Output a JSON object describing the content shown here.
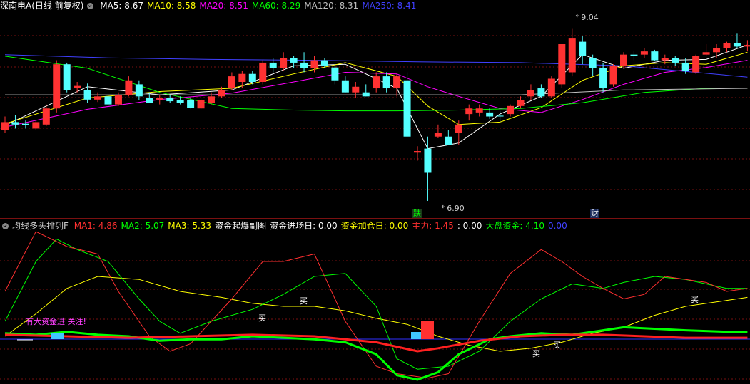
{
  "header1": {
    "title": "深南电A(日线 前复权)",
    "ma": [
      {
        "label": "MA5: 8.67",
        "color": "#ffffff"
      },
      {
        "label": "MA10: 8.58",
        "color": "#ffff00"
      },
      {
        "label": "MA20: 8.51",
        "color": "#ff00ff"
      },
      {
        "label": "MA60: 8.29",
        "color": "#00ff00"
      },
      {
        "label": "MA120: 8.31",
        "color": "#c0c0c0"
      },
      {
        "label": "MA250: 8.41",
        "color": "#4040ff"
      }
    ]
  },
  "header2": {
    "title": "均线多头排列F",
    "items": [
      {
        "label": "MA1: 4.86",
        "color": "#ff3030"
      },
      {
        "label": "MA2: 5.07",
        "color": "#00ff00"
      },
      {
        "label": "MA3: 5.33",
        "color": "#ffff00"
      },
      {
        "label": "资金起爆副图",
        "color": "#ffffff"
      },
      {
        "label": "资金进场日: 0.00",
        "color": "#ffffff"
      },
      {
        "label": "资金加仓日: 0.00",
        "color": "#ffff00"
      },
      {
        "label": "主力: 1.45",
        "color": "#ff3030"
      },
      {
        "label": ": 0.00",
        "color": "#ffffff"
      },
      {
        "label": "大盘资金: 4.10",
        "color": "#00ff00"
      },
      {
        "label": "0.00",
        "color": "#4040ff"
      }
    ]
  },
  "annotations": {
    "high": "9.04",
    "low": "6.90",
    "tag_die": "跌",
    "tag_cai": "财",
    "capital_note": "有大资金进 关注!",
    "buy": "买"
  },
  "colors": {
    "up": "#ff3232",
    "down": "#54ffff",
    "grid": "#7a1010"
  },
  "chart_data": {
    "type": "candlestick",
    "title": "深南电A(日线 前复权)",
    "high_label": 9.04,
    "low_label": 6.9,
    "ohlc": [
      [
        7.78,
        7.95,
        7.75,
        7.88
      ],
      [
        7.88,
        7.97,
        7.8,
        7.85
      ],
      [
        7.86,
        7.9,
        7.8,
        7.84
      ],
      [
        7.8,
        7.9,
        7.78,
        7.88
      ],
      [
        7.85,
        8.1,
        7.83,
        8.05
      ],
      [
        8.05,
        8.65,
        8.0,
        8.6
      ],
      [
        8.6,
        8.62,
        8.25,
        8.28
      ],
      [
        8.3,
        8.38,
        8.25,
        8.33
      ],
      [
        8.28,
        8.36,
        8.12,
        8.16
      ],
      [
        8.16,
        8.25,
        8.13,
        8.2
      ],
      [
        8.2,
        8.28,
        8.15,
        8.1
      ],
      [
        8.1,
        8.25,
        8.08,
        8.22
      ],
      [
        8.22,
        8.45,
        8.2,
        8.4
      ],
      [
        8.35,
        8.4,
        8.15,
        8.2
      ],
      [
        8.18,
        8.25,
        8.12,
        8.12
      ],
      [
        8.16,
        8.22,
        8.1,
        8.18
      ],
      [
        8.18,
        8.22,
        8.12,
        8.14
      ],
      [
        8.15,
        8.2,
        8.1,
        8.12
      ],
      [
        8.15,
        8.18,
        8.05,
        8.06
      ],
      [
        8.05,
        8.18,
        8.04,
        8.15
      ],
      [
        8.12,
        8.25,
        8.1,
        8.2
      ],
      [
        8.2,
        8.32,
        8.18,
        8.28
      ],
      [
        8.3,
        8.5,
        8.28,
        8.45
      ],
      [
        8.38,
        8.52,
        8.3,
        8.48
      ],
      [
        8.48,
        8.52,
        8.35,
        8.38
      ],
      [
        8.38,
        8.65,
        8.35,
        8.62
      ],
      [
        8.62,
        8.68,
        8.5,
        8.55
      ],
      [
        8.55,
        8.75,
        8.52,
        8.68
      ],
      [
        8.68,
        8.7,
        8.55,
        8.62
      ],
      [
        8.62,
        8.75,
        8.5,
        8.55
      ],
      [
        8.55,
        8.7,
        8.5,
        8.65
      ],
      [
        8.65,
        8.68,
        8.55,
        8.58
      ],
      [
        8.56,
        8.6,
        8.35,
        8.4
      ],
      [
        8.4,
        8.45,
        8.25,
        8.25
      ],
      [
        8.25,
        8.38,
        8.18,
        8.32
      ],
      [
        8.25,
        8.35,
        8.2,
        8.2
      ],
      [
        8.3,
        8.5,
        8.25,
        8.45
      ],
      [
        8.45,
        8.5,
        8.25,
        8.3
      ],
      [
        8.3,
        8.48,
        8.2,
        8.45
      ],
      [
        8.4,
        8.5,
        7.7,
        7.7
      ],
      [
        7.5,
        7.58,
        7.4,
        7.52
      ],
      [
        7.55,
        7.7,
        6.9,
        7.25
      ],
      [
        7.7,
        7.85,
        7.68,
        7.75
      ],
      [
        7.7,
        7.78,
        7.6,
        7.6
      ],
      [
        7.75,
        7.9,
        7.6,
        7.85
      ],
      [
        7.98,
        8.1,
        7.9,
        8.05
      ],
      [
        8.0,
        8.1,
        7.95,
        8.05
      ],
      [
        8.0,
        8.06,
        7.92,
        7.95
      ],
      [
        7.96,
        8.02,
        7.88,
        7.95
      ],
      [
        7.98,
        8.1,
        7.95,
        8.08
      ],
      [
        8.08,
        8.2,
        8.05,
        8.15
      ],
      [
        8.2,
        8.35,
        8.15,
        8.28
      ],
      [
        8.3,
        8.35,
        8.18,
        8.2
      ],
      [
        8.2,
        8.45,
        8.18,
        8.42
      ],
      [
        8.35,
        8.8,
        8.3,
        8.85
      ],
      [
        8.5,
        9.04,
        8.45,
        8.92
      ],
      [
        8.88,
        8.95,
        8.6,
        8.7
      ],
      [
        8.68,
        8.72,
        8.45,
        8.55
      ],
      [
        8.55,
        8.62,
        8.25,
        8.3
      ],
      [
        8.35,
        8.6,
        8.32,
        8.58
      ],
      [
        8.58,
        8.75,
        8.55,
        8.72
      ],
      [
        8.72,
        8.76,
        8.65,
        8.7
      ],
      [
        8.72,
        8.8,
        8.68,
        8.76
      ],
      [
        8.76,
        8.78,
        8.64,
        8.65
      ],
      [
        8.65,
        8.72,
        8.6,
        8.68
      ],
      [
        8.68,
        8.7,
        8.58,
        8.62
      ],
      [
        8.62,
        8.68,
        8.48,
        8.52
      ],
      [
        8.5,
        8.72,
        8.48,
        8.7
      ],
      [
        8.72,
        8.85,
        8.7,
        8.75
      ],
      [
        8.75,
        8.85,
        8.68,
        8.8
      ],
      [
        8.8,
        8.88,
        8.75,
        8.86
      ],
      [
        8.86,
        8.98,
        8.8,
        8.82
      ],
      [
        8.82,
        8.9,
        8.76,
        8.84
      ]
    ],
    "series": [
      {
        "name": "MA5",
        "color": "#ffffff",
        "values": [
          [
            0,
            7.84
          ],
          [
            8,
            8.32
          ],
          [
            15,
            8.22
          ],
          [
            22,
            8.28
          ],
          [
            28,
            8.58
          ],
          [
            33,
            8.6
          ],
          [
            38,
            8.3
          ],
          [
            41,
            7.55
          ],
          [
            44,
            7.62
          ],
          [
            48,
            7.98
          ],
          [
            52,
            8.2
          ],
          [
            56,
            8.72
          ],
          [
            60,
            8.55
          ],
          [
            64,
            8.65
          ],
          [
            68,
            8.66
          ],
          [
            72,
            8.84
          ]
        ]
      },
      {
        "name": "MA10",
        "color": "#ffff00",
        "values": [
          [
            0,
            7.86
          ],
          [
            8,
            8.18
          ],
          [
            15,
            8.26
          ],
          [
            22,
            8.3
          ],
          [
            28,
            8.48
          ],
          [
            33,
            8.62
          ],
          [
            38,
            8.45
          ],
          [
            41,
            8.08
          ],
          [
            44,
            7.85
          ],
          [
            48,
            7.88
          ],
          [
            52,
            8.06
          ],
          [
            56,
            8.4
          ],
          [
            60,
            8.58
          ],
          [
            64,
            8.62
          ],
          [
            68,
            8.6
          ],
          [
            72,
            8.75
          ]
        ]
      },
      {
        "name": "MA20",
        "color": "#ff00ff",
        "values": [
          [
            0,
            7.82
          ],
          [
            8,
            8.04
          ],
          [
            15,
            8.16
          ],
          [
            22,
            8.24
          ],
          [
            28,
            8.38
          ],
          [
            33,
            8.5
          ],
          [
            38,
            8.48
          ],
          [
            41,
            8.32
          ],
          [
            44,
            8.2
          ],
          [
            48,
            8.05
          ],
          [
            52,
            8.0
          ],
          [
            56,
            8.16
          ],
          [
            60,
            8.35
          ],
          [
            64,
            8.5
          ],
          [
            68,
            8.56
          ],
          [
            72,
            8.65
          ]
        ]
      },
      {
        "name": "MA60",
        "color": "#00ff00",
        "values": [
          [
            0,
            8.7
          ],
          [
            8,
            8.55
          ],
          [
            15,
            8.25
          ],
          [
            22,
            8.05
          ],
          [
            28,
            8.03
          ],
          [
            33,
            8.02
          ],
          [
            38,
            8.02
          ],
          [
            44,
            8.03
          ],
          [
            50,
            8.05
          ],
          [
            56,
            8.12
          ],
          [
            62,
            8.25
          ],
          [
            68,
            8.3
          ],
          [
            72,
            8.3
          ]
        ]
      },
      {
        "name": "MA120",
        "color": "#c0c0c0",
        "values": [
          [
            0,
            8.22
          ],
          [
            10,
            8.22
          ],
          [
            20,
            8.22
          ],
          [
            30,
            8.22
          ],
          [
            40,
            8.22
          ],
          [
            50,
            8.22
          ],
          [
            60,
            8.28
          ],
          [
            72,
            8.3
          ]
        ]
      },
      {
        "name": "MA250",
        "color": "#4040ff",
        "values": [
          [
            0,
            8.72
          ],
          [
            10,
            8.68
          ],
          [
            20,
            8.66
          ],
          [
            30,
            8.65
          ],
          [
            40,
            8.63
          ],
          [
            50,
            8.62
          ],
          [
            60,
            8.58
          ],
          [
            72,
            8.44
          ]
        ]
      }
    ],
    "subchart": {
      "MA1": [
        [
          0,
          60
        ],
        [
          3,
          100
        ],
        [
          6,
          90
        ],
        [
          9,
          85
        ],
        [
          11,
          60
        ],
        [
          14,
          30
        ],
        [
          16,
          20
        ],
        [
          18,
          25
        ],
        [
          22,
          55
        ],
        [
          25,
          80
        ],
        [
          27,
          80
        ],
        [
          30,
          85
        ],
        [
          33,
          40
        ],
        [
          36,
          10
        ],
        [
          38,
          5
        ],
        [
          41,
          2
        ],
        [
          43,
          5
        ],
        [
          46,
          40
        ],
        [
          49,
          72
        ],
        [
          52,
          88
        ],
        [
          54,
          80
        ],
        [
          56,
          70
        ],
        [
          58,
          62
        ],
        [
          60,
          55
        ],
        [
          62,
          58
        ],
        [
          64,
          70
        ],
        [
          68,
          66
        ],
        [
          70,
          60
        ],
        [
          72,
          62
        ]
      ],
      "MA2": [
        [
          0,
          40
        ],
        [
          3,
          80
        ],
        [
          5,
          95
        ],
        [
          7,
          88
        ],
        [
          10,
          80
        ],
        [
          13,
          55
        ],
        [
          15,
          40
        ],
        [
          17,
          32
        ],
        [
          20,
          40
        ],
        [
          24,
          48
        ],
        [
          27,
          58
        ],
        [
          30,
          70
        ],
        [
          33,
          72
        ],
        [
          36,
          50
        ],
        [
          38,
          15
        ],
        [
          40,
          8
        ],
        [
          43,
          10
        ],
        [
          46,
          20
        ],
        [
          49,
          40
        ],
        [
          52,
          55
        ],
        [
          55,
          65
        ],
        [
          58,
          62
        ],
        [
          60,
          66
        ],
        [
          63,
          70
        ],
        [
          66,
          68
        ],
        [
          70,
          62
        ],
        [
          72,
          62
        ]
      ],
      "MA3": [
        [
          0,
          30
        ],
        [
          3,
          45
        ],
        [
          6,
          62
        ],
        [
          9,
          70
        ],
        [
          13,
          68
        ],
        [
          17,
          60
        ],
        [
          21,
          56
        ],
        [
          24,
          52
        ],
        [
          27,
          50
        ],
        [
          30,
          50
        ],
        [
          33,
          47
        ],
        [
          36,
          42
        ],
        [
          39,
          38
        ],
        [
          42,
          30
        ],
        [
          45,
          24
        ],
        [
          48,
          20
        ],
        [
          51,
          22
        ],
        [
          54,
          26
        ],
        [
          57,
          32
        ],
        [
          60,
          36
        ],
        [
          63,
          44
        ],
        [
          66,
          50
        ],
        [
          70,
          54
        ],
        [
          72,
          56
        ]
      ],
      "大盘资金": [
        [
          0,
          32
        ],
        [
          3,
          31
        ],
        [
          6,
          33
        ],
        [
          9,
          31
        ],
        [
          12,
          30
        ],
        [
          15,
          27
        ],
        [
          18,
          28
        ],
        [
          21,
          28
        ],
        [
          24,
          30
        ],
        [
          27,
          29
        ],
        [
          30,
          28
        ],
        [
          33,
          26
        ],
        [
          36,
          18
        ],
        [
          38,
          4
        ],
        [
          40,
          1
        ],
        [
          42,
          6
        ],
        [
          44,
          18
        ],
        [
          47,
          28
        ],
        [
          49,
          30
        ],
        [
          52,
          32
        ],
        [
          55,
          31
        ],
        [
          58,
          34
        ],
        [
          60,
          36
        ],
        [
          63,
          35
        ],
        [
          66,
          34
        ],
        [
          70,
          33
        ],
        [
          72,
          33
        ]
      ],
      "主力": [
        [
          0,
          31
        ],
        [
          6,
          30
        ],
        [
          12,
          29
        ],
        [
          18,
          30
        ],
        [
          24,
          31
        ],
        [
          30,
          30
        ],
        [
          36,
          26
        ],
        [
          40,
          20
        ],
        [
          42,
          22
        ],
        [
          46,
          27
        ],
        [
          50,
          30
        ],
        [
          54,
          31
        ],
        [
          58,
          31
        ],
        [
          62,
          30
        ],
        [
          66,
          29
        ],
        [
          72,
          29
        ]
      ]
    }
  }
}
